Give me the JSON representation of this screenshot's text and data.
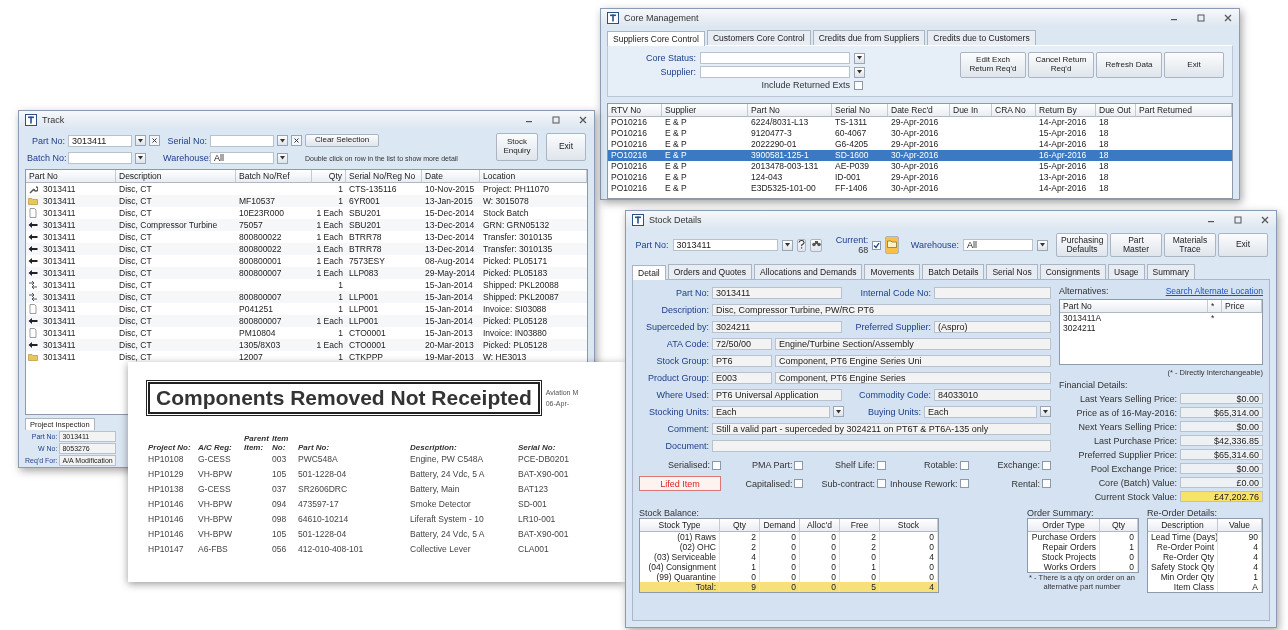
{
  "core": {
    "title": "Core Management",
    "tabs": [
      {
        "label": "Suppliers Core Control",
        "selected": true
      },
      {
        "label": "Customers Core Control",
        "selected": false
      },
      {
        "label": "Credits due from Suppliers",
        "selected": false
      },
      {
        "label": "Credits due to Customers",
        "selected": false
      }
    ],
    "fields": [
      {
        "label": "Core Status:"
      },
      {
        "label": "Supplier:"
      }
    ],
    "include_returned": {
      "label": "Include Returned Exts",
      "checked": false
    },
    "buttons": [
      "Edit Exch Return Req'd",
      "Cancel Return Req'd",
      "Refresh Data",
      "Exit"
    ],
    "columns": [
      "RTV No",
      "Supplier",
      "Part No",
      "Serial No",
      "Date Rec'd",
      "Due In",
      "CRA No",
      "Return By",
      "Due Out",
      "Part Returned"
    ],
    "rows": [
      {
        "selected": false,
        "cells": [
          "PO10216",
          "E & P",
          "6224/8031-L13",
          "TS-1311",
          "29-Apr-2016",
          null,
          null,
          "14-Apr-2016",
          "18",
          null
        ]
      },
      {
        "selected": false,
        "cells": [
          "PO10216",
          "E & P",
          "9120477-3",
          "60-4067",
          "30-Apr-2016",
          null,
          null,
          "15-Apr-2016",
          "18",
          null
        ]
      },
      {
        "selected": false,
        "cells": [
          "PO10216",
          "E & P",
          "2022290-01",
          "G6-4205",
          "29-Apr-2016",
          null,
          null,
          "14-Apr-2016",
          "18",
          null
        ]
      },
      {
        "selected": true,
        "cells": [
          "PO10216",
          "E & P",
          "3900581-125-1",
          "SD-1600",
          "30-Apr-2016",
          null,
          null,
          "16-Apr-2016",
          "18",
          null
        ]
      },
      {
        "selected": false,
        "cells": [
          "PO10216",
          "E & P",
          "2013478-003-131",
          "AE-P039",
          "30-Apr-2016",
          null,
          null,
          "15-Apr-2016",
          "18",
          null
        ]
      },
      {
        "selected": false,
        "cells": [
          "PO10216",
          "E & P",
          "124-043",
          "ID-001",
          "29-Apr-2016",
          null,
          null,
          "13-Apr-2016",
          "18",
          null
        ]
      },
      {
        "selected": false,
        "cells": [
          "PO10216",
          "E & P",
          "E3D5325-101-00",
          "FF-1406",
          "30-Apr-2016",
          null,
          null,
          "14-Apr-2016",
          "18",
          null
        ]
      }
    ]
  },
  "track": {
    "title": "Track",
    "fields": [
      {
        "label": "Part No:",
        "value": "3013411"
      },
      {
        "label": "Serial No:"
      },
      {
        "label": "Batch No:"
      },
      {
        "label": "Warehouse:",
        "value": "All"
      }
    ],
    "hint": "Double click on row in the list to show more detail",
    "buttons": [
      "Clear Selection",
      "Stock Enquiry",
      "Exit"
    ],
    "columns": [
      "Part No",
      "Description",
      "Batch No/Ref",
      "Qty",
      "Serial No/Reg No",
      "Date",
      "Location"
    ],
    "rows": [
      {
        "kind": "tool",
        "cells": [
          "3013411",
          "Disc, CT",
          null,
          "1",
          "CTS-135116",
          "10-Nov-2015",
          "Project: PH11070"
        ]
      },
      {
        "kind": "folder",
        "cells": [
          "3013411",
          "Disc, CT",
          "MF10537",
          "1",
          "6YR001",
          "13-Jan-2015",
          "W: 3015078"
        ]
      },
      {
        "kind": "doc",
        "cells": [
          "3013411",
          "Disc, CT",
          "10E23R000",
          "1 Each",
          "SBU201",
          "15-Dec-2014",
          "Stock Batch"
        ]
      },
      {
        "kind": "arrow",
        "cells": [
          "3013411",
          "Disc, Compressor Turbine",
          "75057",
          "1 Each",
          "SBU201",
          "13-Dec-2014",
          "GRN: GRN05132"
        ]
      },
      {
        "kind": "arrow",
        "cells": [
          "3013411",
          "Disc, CT",
          "800800022",
          "1 Each",
          "BTRR78",
          "13-Dec-2014",
          "Transfer: 3010135"
        ]
      },
      {
        "kind": "arrow",
        "cells": [
          "3013411",
          "Disc, CT",
          "800800022",
          "1 Each",
          "BTRR78",
          "13-Dec-2014",
          "Transfer: 3010135"
        ]
      },
      {
        "kind": "arrow",
        "cells": [
          "3013411",
          "Disc, CT",
          "800800001",
          "1 Each",
          "7573ESY",
          "08-Aug-2014",
          "Picked: PL05171"
        ]
      },
      {
        "kind": "arrow",
        "cells": [
          "3013411",
          "Disc, CT",
          "800800007",
          "1 Each",
          "LLP083",
          "29-May-2014",
          "Picked: PL05183"
        ]
      },
      {
        "kind": "ship",
        "cells": [
          "3013411",
          "Disc, CT",
          null,
          "1",
          null,
          "15-Jan-2014",
          "Shipped: PKL20088"
        ]
      },
      {
        "kind": "ship",
        "cells": [
          "3013411",
          "Disc, CT",
          "800800007",
          "1",
          "LLP001",
          "15-Jan-2014",
          "Shipped: PKL20087"
        ]
      },
      {
        "kind": "doc",
        "cells": [
          "3013411",
          "Disc, CT",
          "P041251",
          "1",
          "LLP001",
          "15-Jan-2014",
          "Invoice: SI03088"
        ]
      },
      {
        "kind": "arrow",
        "cells": [
          "3013411",
          "Disc, CT",
          "800800007",
          "1 Each",
          "LLP001",
          "15-Jan-2014",
          "Picked: PL05128"
        ]
      },
      {
        "kind": "doc",
        "cells": [
          "3013411",
          "Disc, CT",
          "PM10804",
          "1",
          "CTO0001",
          "15-Jan-2013",
          "Invoice: IN03880"
        ]
      },
      {
        "kind": "arrow",
        "cells": [
          "3013411",
          "Disc, CT",
          "1305/8X03",
          "1 Each",
          "CTO0001",
          "20-Mar-2013",
          "Picked: PL05128"
        ]
      },
      {
        "kind": "folder",
        "cells": [
          "3013411",
          "Disc, CT",
          "12007",
          "1",
          "CTKPPP",
          "19-Mar-2013",
          "W: HE3013"
        ]
      }
    ],
    "bottom_tab": "Project Inspection",
    "bottom_fields": [
      {
        "label": "Part No:",
        "value": "3013411"
      },
      {
        "label": "W No:",
        "value": "8053276"
      },
      {
        "label": "Req'd For:",
        "value": "A/A Modification"
      }
    ]
  },
  "report": {
    "title": "Components Removed Not Receipted",
    "side": [
      "Aviation M",
      "06-Apr-"
    ],
    "columns": [
      "Project No:",
      "A/C Reg:",
      "Parent Item:",
      "Item No:",
      "Part No:",
      "Description:",
      "Serial No:"
    ],
    "rows": [
      [
        "HP10108",
        "G-CESS",
        null,
        "003",
        "PWC548A",
        "Engine, PW C548A",
        "PCE-DB0201"
      ],
      [
        "HP10129",
        "VH-BPW",
        null,
        "105",
        "501-1228-04",
        "Battery, 24 Vdc, 5 A",
        "BAT-X90-001"
      ],
      [
        "HP10138",
        "G-CESS",
        null,
        "037",
        "SR2606DRC",
        "Battery, Main",
        "BAT123"
      ],
      [
        "HP10146",
        "VH-BPW",
        null,
        "094",
        "473597-17",
        "Smoke Detector",
        "SD-001"
      ],
      [
        "HP10146",
        "VH-BPW",
        null,
        "098",
        "64610-10214",
        "Liferaft System - 10",
        "LR10-001"
      ],
      [
        "HP10146",
        "VH-BPW",
        null,
        "105",
        "501-1228-04",
        "Battery, 24 Vdc, 5 A",
        "BAT-X90-001"
      ],
      [
        "HP10147",
        "A6-FBS",
        null,
        "056",
        "412-010-408-101",
        "Collective Lever",
        "CLA001"
      ]
    ]
  },
  "stock": {
    "title": "Stock Details",
    "part_no": {
      "label": "Part No:",
      "value": "3013411"
    },
    "current": {
      "label": "Current:",
      "value": "68",
      "checked": true
    },
    "warehouse": {
      "label": "Warehouse:",
      "value": "All"
    },
    "buttons": [
      "Purchasing Defaults",
      "Part Master",
      "Materials Trace",
      "Exit"
    ],
    "tabs": [
      {
        "label": "Detail",
        "selected": true
      },
      {
        "label": "Orders and Quotes",
        "selected": false
      },
      {
        "label": "Allocations and Demands",
        "selected": false
      },
      {
        "label": "Movements",
        "selected": false
      },
      {
        "label": "Batch Details",
        "selected": false
      },
      {
        "label": "Serial Nos",
        "selected": false
      },
      {
        "label": "Consignments",
        "selected": false
      },
      {
        "label": "Usage",
        "selected": false
      },
      {
        "label": "Summary",
        "selected": false
      }
    ],
    "detail_rows": [
      {
        "kind": "pair",
        "fields": [
          {
            "label": "Part No:",
            "value": "3013411"
          },
          {
            "label": "Internal Code No:"
          }
        ]
      },
      {
        "kind": "wide",
        "fields": [
          {
            "label": "Description:",
            "value": "Disc, Compressor Turbine, PW/RC PT6"
          }
        ]
      },
      {
        "kind": "pair",
        "fields": [
          {
            "label": "Superceded by:",
            "value": "3024211"
          },
          {
            "label": "Preferred Supplier:",
            "value": "(Aspro)"
          }
        ]
      },
      {
        "kind": "code",
        "fields": [
          {
            "label": "ATA Code:",
            "value": "72/50/00",
            "detail": "Engine/Turbine Section/Assembly"
          }
        ]
      },
      {
        "kind": "code",
        "fields": [
          {
            "label": "Stock Group:",
            "value": "PT6",
            "detail": "Component, PT6 Engine Series Uni"
          }
        ]
      },
      {
        "kind": "code",
        "fields": [
          {
            "label": "Product Group:",
            "value": "E003",
            "detail": "Component, PT6 Engine Series"
          }
        ]
      },
      {
        "kind": "pair",
        "fields": [
          {
            "label": "Where Used:",
            "value": "PT6 Universal Application"
          },
          {
            "label": "Commodity Code:",
            "value": "84033010"
          }
        ]
      },
      {
        "kind": "dropdowns",
        "fields": [
          {
            "label": "Stocking Units:",
            "value": "Each"
          },
          {
            "label": "Buying Units:",
            "value": "Each"
          }
        ]
      },
      {
        "kind": "wide",
        "fields": [
          {
            "label": "Comment:",
            "value": "Still a valid part - superceded by 3024211 on PT6T & PT6A-135 only"
          }
        ]
      },
      {
        "kind": "wide",
        "fields": [
          {
            "label": "Document:"
          }
        ]
      }
    ],
    "lifed_badge": "Lifed Item",
    "flags": [
      {
        "label": "Serialised:",
        "checked": false
      },
      {
        "label": "PMA Part:",
        "checked": false
      },
      {
        "label": "Shelf Life:",
        "checked": false
      },
      {
        "label": "Rotable:",
        "checked": false
      },
      {
        "label": "Exchange:",
        "checked": false
      },
      {
        "label": "Capitalised:",
        "checked": false
      },
      {
        "label": "Sub-contract:",
        "checked": false
      },
      {
        "label": "Inhouse Rework:",
        "checked": false
      },
      {
        "label": "Rental:",
        "checked": false
      }
    ],
    "alternatives": {
      "label": "Alternatives:",
      "link": "Search Alternate Location",
      "columns": [
        "Part No",
        "*",
        "Price"
      ],
      "rows": [
        [
          "3013411A",
          "*",
          null
        ],
        [
          "3024211",
          null,
          null
        ]
      ],
      "note": "(* - Directly Interchangeable)"
    },
    "financial": {
      "label": "Financial Details:",
      "rows": [
        {
          "label": "Last Years Selling Price:",
          "value": "$0.00",
          "highlight": false
        },
        {
          "label": "Price as of 16-May-2016:",
          "value": "$65,314.00",
          "highlight": false
        },
        {
          "label": "Next Years Selling Price:",
          "value": "$0.00",
          "highlight": false
        },
        {
          "label": "Last Purchase Price:",
          "value": "$42,336.85",
          "highlight": false
        },
        {
          "label": "Preferred Supplier Price:",
          "value": "$65,314.60",
          "highlight": false
        },
        {
          "label": "Pool Exchange Price:",
          "value": "$0.00",
          "highlight": false
        },
        {
          "label": "Core (Batch) Value:",
          "value": "£0.00",
          "highlight": false
        },
        {
          "label": "Current Stock Value:",
          "value": "£47,202.76",
          "highlight": true
        }
      ]
    },
    "balance": {
      "label": "Stock Balance:",
      "columns": [
        "Stock Type",
        "Qty",
        "Demand",
        "Alloc'd",
        "Free",
        "Stock"
      ],
      "rows": [
        {
          "total": false,
          "cells": [
            "(01) Raws",
            "2",
            "0",
            "0",
            "2",
            "0"
          ]
        },
        {
          "total": false,
          "cells": [
            "(02) OHC",
            "2",
            "0",
            "0",
            "2",
            "0"
          ]
        },
        {
          "total": false,
          "cells": [
            "(03) Serviceable",
            "4",
            "0",
            "0",
            "0",
            "4"
          ]
        },
        {
          "total": false,
          "cells": [
            "(04) Consignment",
            "1",
            "0",
            "0",
            "1",
            "0"
          ]
        },
        {
          "total": false,
          "cells": [
            "(99) Quarantine",
            "0",
            "0",
            "0",
            "0",
            "0"
          ]
        },
        {
          "total": true,
          "cells": [
            "Total:",
            "9",
            "0",
            "0",
            "5",
            "4"
          ]
        }
      ]
    },
    "orders": {
      "label": "Order Summary:",
      "columns": [
        "Order Type",
        "Qty"
      ],
      "rows": [
        [
          "Purchase Orders",
          "0"
        ],
        [
          "Repair Orders",
          "1"
        ],
        [
          "Stock Projects",
          "0"
        ],
        [
          "Works Orders",
          "0"
        ]
      ],
      "note": "* - There is a qty on order on an alternative part number"
    },
    "reorder": {
      "label": "Re-Order Details:",
      "columns": [
        "Description",
        "Value"
      ],
      "rows": [
        [
          "Lead Time (Days)",
          "90"
        ],
        [
          "Re-Order Point",
          "4"
        ],
        [
          "Re-Order Qty",
          "4"
        ],
        [
          "Safety Stock Qty",
          "4"
        ],
        [
          "Min Order Qty",
          "1"
        ],
        [
          "Item Class",
          "A"
        ]
      ]
    }
  }
}
